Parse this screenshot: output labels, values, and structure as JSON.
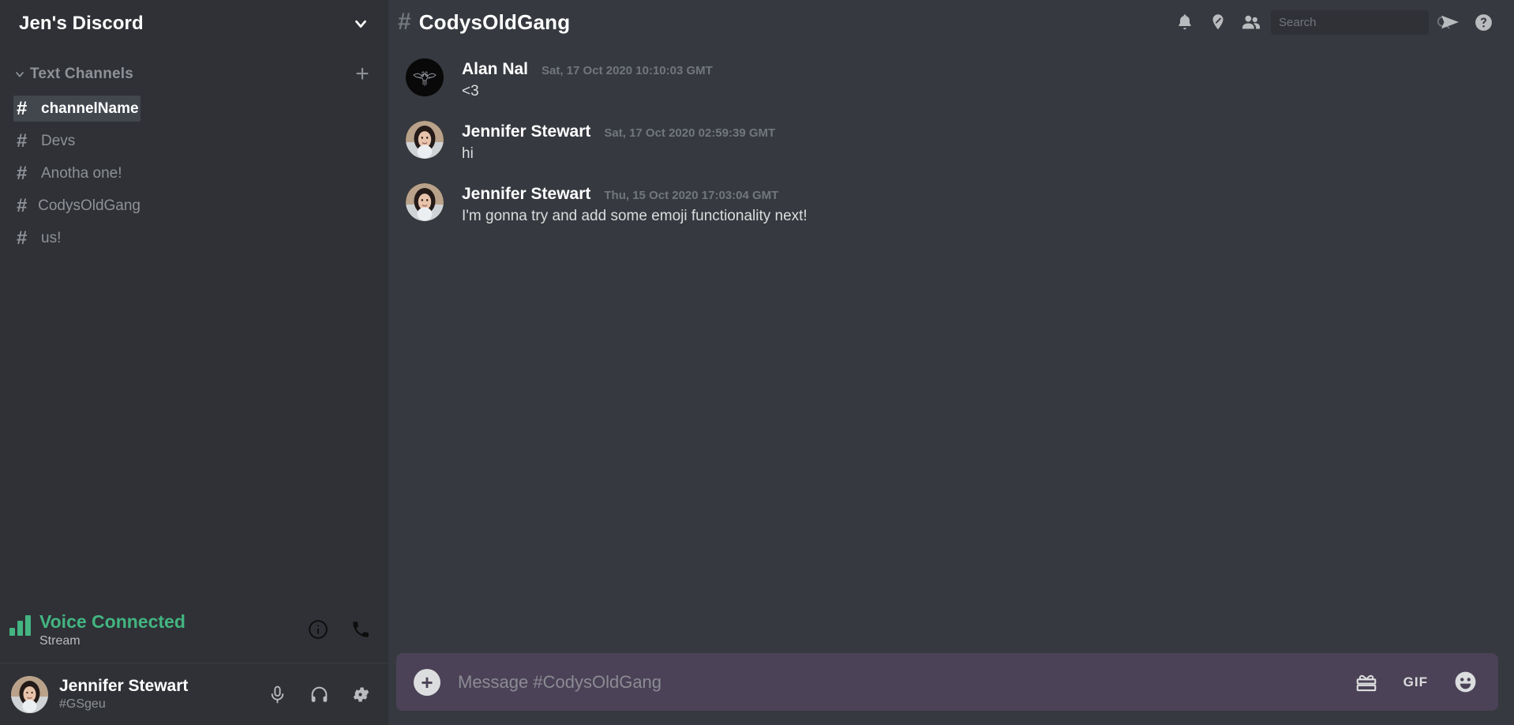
{
  "sidebar": {
    "server_name": "Jen's Discord",
    "server_dropdown_icon": "chevron-down-icon",
    "section": {
      "title": "Text Channels",
      "caret_icon": "chevron-down-icon",
      "add_label": "+"
    },
    "channels": [
      {
        "name": "channelName",
        "hash": "#",
        "active": true
      },
      {
        "name": "Devs",
        "hash": "#",
        "active": false
      },
      {
        "name": "Anotha one!",
        "hash": "#",
        "active": false
      },
      {
        "name": "CodysOldGang",
        "hash": "#",
        "active": false
      },
      {
        "name": "us!",
        "hash": "#",
        "active": false
      }
    ],
    "voice": {
      "status": "Voice Connected",
      "sub": "Stream",
      "info_icon": "info-circle-icon",
      "call_icon": "phone-icon",
      "accent": "#43b581"
    },
    "user": {
      "name": "Jennifer Stewart",
      "tag": "#GSgeu",
      "mic_icon": "microphone-icon",
      "headphones_icon": "headphones-icon",
      "settings_icon": "gear-icon"
    }
  },
  "topbar": {
    "hash": "#",
    "channel_title": "CodysOldGang",
    "icons": {
      "bell": "bell-icon",
      "pin": "pin-icon",
      "members": "people-icon",
      "search": "search-icon",
      "inbox": "send-icon",
      "help": "help-circle-icon"
    },
    "search_placeholder": "Search",
    "search_value": ""
  },
  "messages": [
    {
      "author": "Alan Nal",
      "timestamp": "Sat, 17 Oct 2020 10:10:03 GMT",
      "text": "<3",
      "avatar": "bat-logo-avatar"
    },
    {
      "author": "Jennifer Stewart",
      "timestamp": "Sat, 17 Oct 2020 02:59:39 GMT",
      "text": "hi",
      "avatar": "photo-avatar"
    },
    {
      "author": "Jennifer Stewart",
      "timestamp": "Thu, 15 Oct 2020 17:03:04 GMT",
      "text": "I'm gonna try and add some emoji functionality next!",
      "avatar": "photo-avatar"
    }
  ],
  "composer": {
    "add_label": "+",
    "placeholder": "Message #CodysOldGang",
    "value": "",
    "gift_icon": "gift-icon",
    "gif_label": "GIF",
    "emoji_icon": "smiley-icon",
    "background": "#4b4257"
  }
}
